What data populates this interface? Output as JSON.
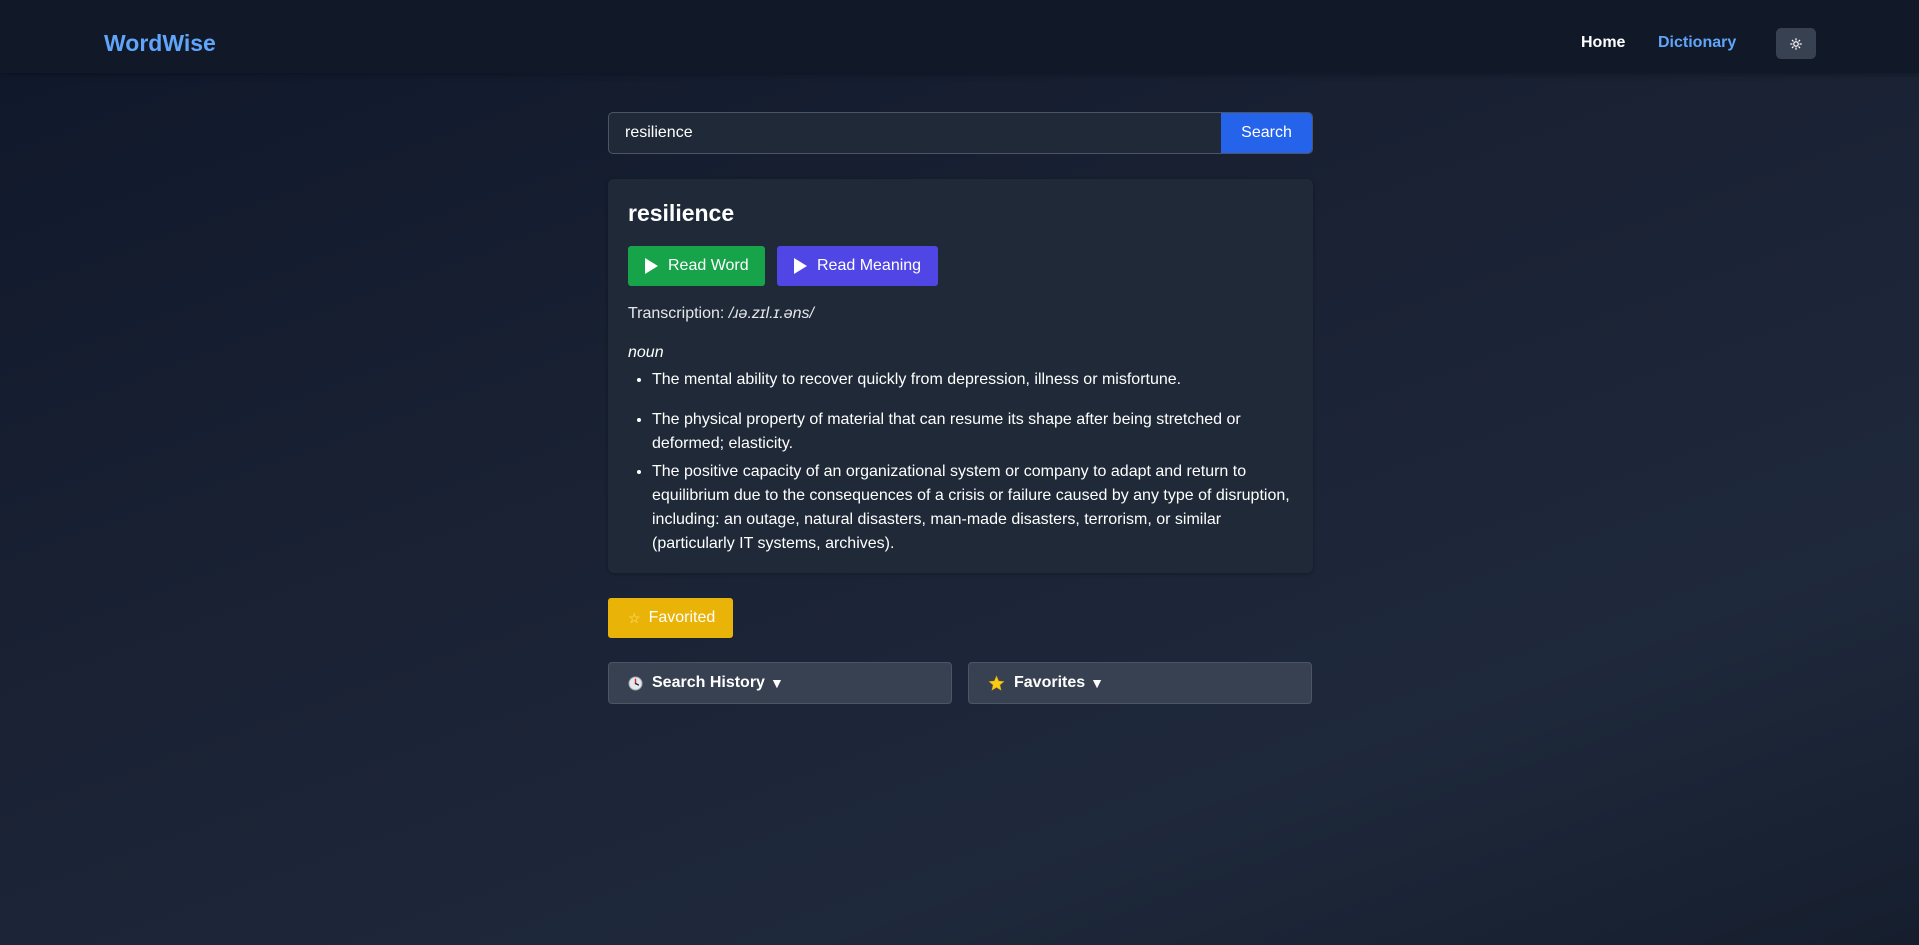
{
  "header": {
    "brand": "WordWise",
    "nav": {
      "home": "Home",
      "dictionary": "Dictionary"
    },
    "theme_toggle_icon": "sun-icon"
  },
  "search": {
    "value": "resilience",
    "button_label": "Search"
  },
  "result": {
    "word": "resilience",
    "read_word_label": "Read Word",
    "read_meaning_label": "Read Meaning",
    "transcription_label": "Transcription:",
    "transcription": "/ɹə.zɪl.ɪ.əns/",
    "part_of_speech": "noun",
    "definitions": [
      "The mental ability to recover quickly from depression, illness or misfortune.",
      "The physical property of material that can resume its shape after being stretched or deformed; elasticity.",
      "The positive capacity of an organizational system or company to adapt and return to equilibrium due to the consequences of a crisis or failure caused by any type of disruption, including: an outage, natural disasters, man-made disasters, terrorism, or similar (particularly IT systems, archives)."
    ]
  },
  "favorite_button": {
    "icon": "star-icon",
    "label": "Favorited"
  },
  "panels": {
    "history": {
      "icon": "clock-icon",
      "label": "Search History",
      "caret": "▼"
    },
    "favorites": {
      "icon": "star-icon",
      "label": "Favorites",
      "caret": "▼"
    }
  },
  "colors": {
    "brand": "#60a5fa",
    "search_button": "#2563eb",
    "read_word_button": "#16a34a",
    "read_meaning_button": "#4f46e5",
    "favorite_button": "#eab308",
    "star": "#facc15"
  }
}
